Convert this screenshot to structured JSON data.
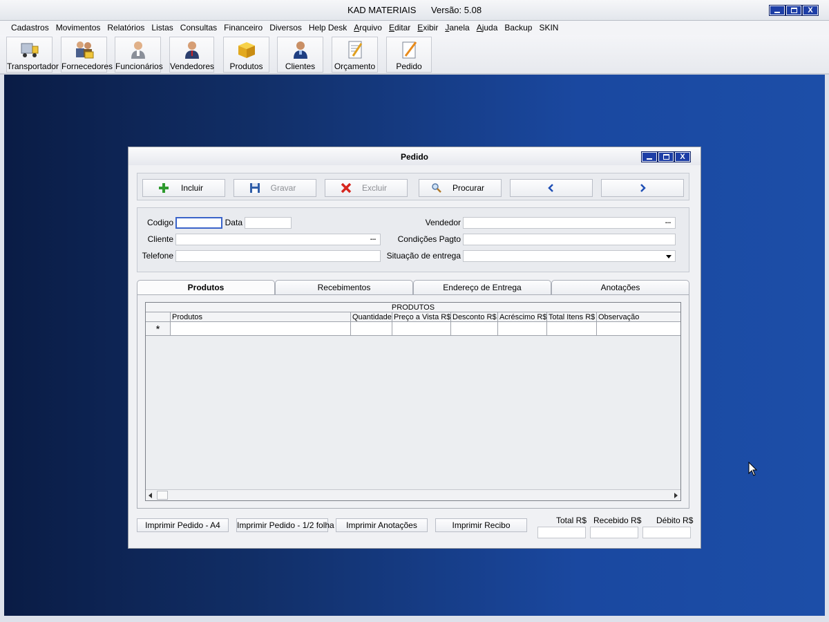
{
  "app": {
    "title": "KAD MATERIAIS      Versão: 5.08",
    "min_label": "",
    "max_label": "",
    "close_label": "X"
  },
  "menu": [
    "Cadastros",
    "Movimentos",
    "Relatórios",
    "Listas",
    "Consultas",
    "Financeiro",
    "Diversos",
    "Help Desk",
    "Arquivo",
    "Editar",
    "Exibir",
    "Janela",
    "Ajuda",
    "Backup",
    "SKIN"
  ],
  "toolbar": [
    {
      "label": "Transportador",
      "icon": "truck-icon"
    },
    {
      "label": "Fornecedores",
      "icon": "suppliers-icon"
    },
    {
      "label": "Funcionários",
      "icon": "employee-icon"
    },
    {
      "label": "Vendedores",
      "icon": "salesman-icon"
    },
    {
      "label": "Produtos",
      "icon": "box-icon"
    },
    {
      "label": "Clientes",
      "icon": "client-icon"
    },
    {
      "label": "Orçamento",
      "icon": "quote-icon"
    },
    {
      "label": "Pedido",
      "icon": "order-icon"
    }
  ],
  "dialog": {
    "title": "Pedido",
    "close_label": "X",
    "actions": {
      "incluir": "Incluir",
      "gravar": "Gravar",
      "excluir": "Excluir",
      "procurar": "Procurar"
    },
    "form": {
      "codigo_label": "Codigo",
      "codigo_value": "",
      "data_label": "Data",
      "data_value": "",
      "cliente_label": "Cliente",
      "cliente_value": "",
      "telefone_label": "Telefone",
      "telefone_value": "",
      "vendedor_label": "Vendedor",
      "vendedor_value": "",
      "condicoes_label": "Condições Pagto",
      "condicoes_value": "",
      "situacao_label": "Situação de entrega",
      "situacao_value": "",
      "ellipsis": "..."
    },
    "tabs": [
      "Produtos",
      "Recebimentos",
      "Endereço de Entrega",
      "Anotações"
    ],
    "grid": {
      "caption": "PRODUTOS",
      "columns": [
        "Produtos",
        "Quantidade",
        "Preço a Vista R$",
        "Desconto R$",
        "Acréscimo R$",
        "Total Itens R$",
        "Observação"
      ],
      "new_row_marker": "*"
    },
    "print_buttons": [
      "Imprimir Pedido - A4",
      "Imprimir Pedido - 1/2 folha",
      "Imprimir Anotações",
      "Imprimir Recibo"
    ],
    "totals": {
      "total_label": "Total R$",
      "total_value": "",
      "recebido_label": "Recebido R$",
      "recebido_value": "",
      "debito_label": "Débito R$",
      "debito_value": ""
    }
  },
  "colors": {
    "title_button": "#1d3ea6",
    "desktop_dark": "#0a1c45",
    "desktop_light": "#1c4ea8",
    "incluir_icon": "#2e9a2e",
    "excluir_icon": "#d6261e"
  }
}
